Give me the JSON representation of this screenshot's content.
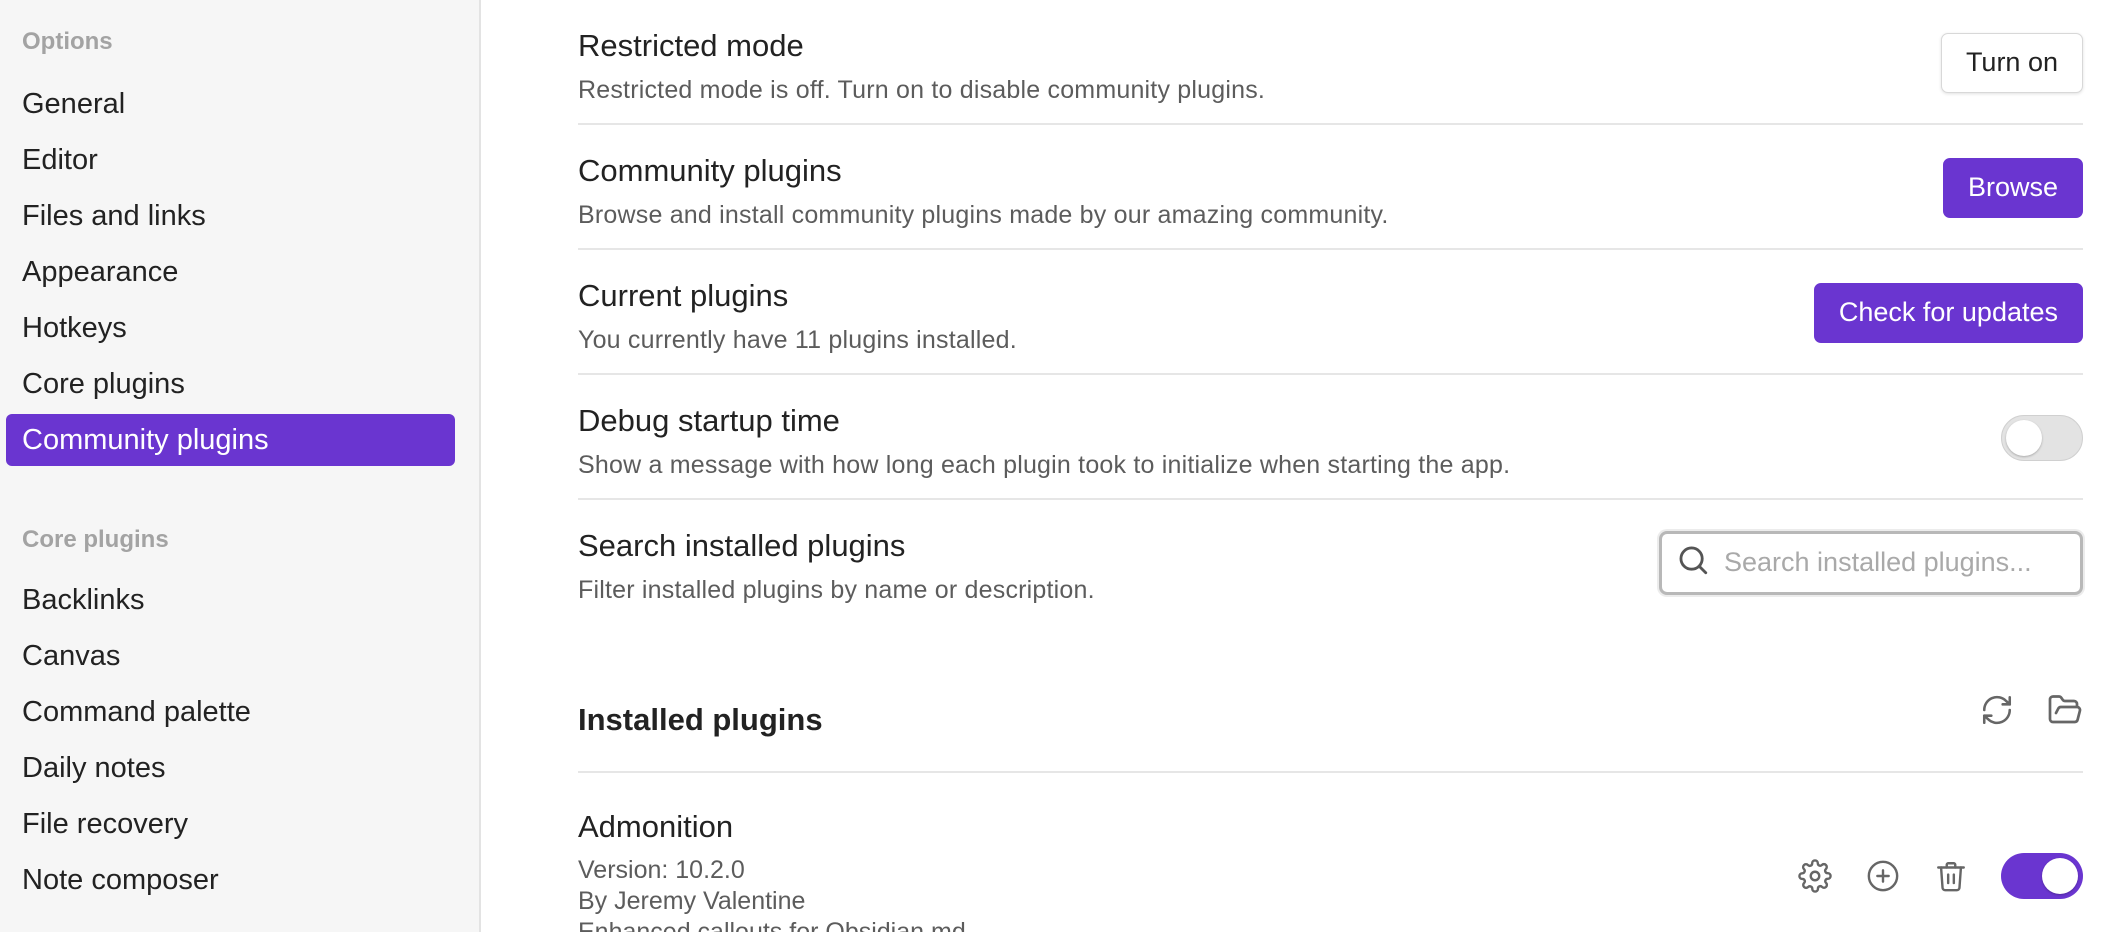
{
  "sidebar": {
    "options_heading": "Options",
    "options_items": [
      {
        "label": "General"
      },
      {
        "label": "Editor"
      },
      {
        "label": "Files and links"
      },
      {
        "label": "Appearance"
      },
      {
        "label": "Hotkeys"
      },
      {
        "label": "Core plugins"
      },
      {
        "label": "Community plugins",
        "active": true
      }
    ],
    "core_heading": "Core plugins",
    "core_items": [
      {
        "label": "Backlinks"
      },
      {
        "label": "Canvas"
      },
      {
        "label": "Command palette"
      },
      {
        "label": "Daily notes"
      },
      {
        "label": "File recovery"
      },
      {
        "label": "Note composer"
      }
    ]
  },
  "settings": {
    "restricted": {
      "name": "Restricted mode",
      "desc": "Restricted mode is off. Turn on to disable community plugins.",
      "button": "Turn on"
    },
    "community": {
      "name": "Community plugins",
      "desc": "Browse and install community plugins made by our amazing community.",
      "button": "Browse"
    },
    "current": {
      "name": "Current plugins",
      "desc": "You currently have 11 plugins installed.",
      "button": "Check for updates"
    },
    "debug": {
      "name": "Debug startup time",
      "desc": "Show a message with how long each plugin took to initialize when starting the app.",
      "enabled": false
    },
    "search": {
      "name": "Search installed plugins",
      "desc": "Filter installed plugins by name or description.",
      "placeholder": "Search installed plugins...",
      "value": ""
    }
  },
  "installed": {
    "heading": "Installed plugins",
    "plugins": [
      {
        "name": "Admonition",
        "version": "Version: 10.2.0",
        "author": "By Jeremy Valentine",
        "description": "Enhanced callouts for Obsidian.md",
        "enabled": true
      }
    ]
  },
  "icons": {
    "search": "search-icon",
    "reload": "reload-icon",
    "folder": "folder-open-icon",
    "settings": "gear-icon",
    "add_hotkey": "plus-circle-icon",
    "uninstall": "trash-icon"
  },
  "colors": {
    "accent": "#6a35d0",
    "sidebar_bg": "#f6f6f6",
    "muted_text": "#5c5c5c",
    "heading_muted": "#a3a3a3"
  }
}
